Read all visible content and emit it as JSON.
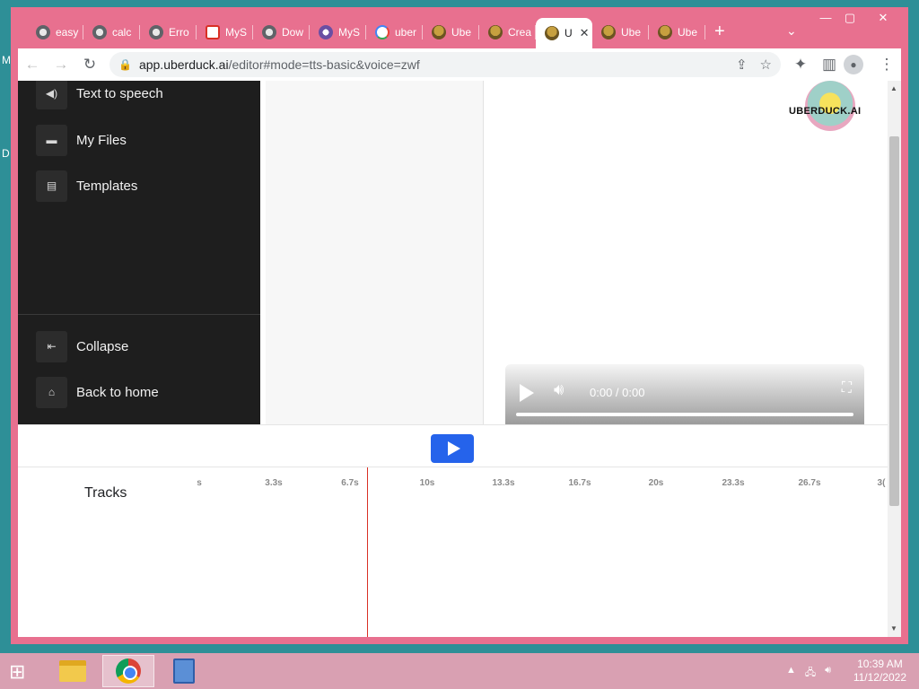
{
  "desktop": {
    "labels": [
      "M",
      "D"
    ]
  },
  "tabs": [
    {
      "label": "easy",
      "icon": "globe"
    },
    {
      "label": "calc",
      "icon": "globe"
    },
    {
      "label": "Erro",
      "icon": "globe"
    },
    {
      "label": "MyS",
      "icon": "red"
    },
    {
      "label": "Dow",
      "icon": "globe"
    },
    {
      "label": "MyS",
      "icon": "owl"
    },
    {
      "label": "uber",
      "icon": "google"
    },
    {
      "label": "Ube",
      "icon": "duck"
    },
    {
      "label": "Crea",
      "icon": "duck"
    },
    {
      "label": "U",
      "icon": "duck",
      "active": true
    },
    {
      "label": "Ube",
      "icon": "duck"
    },
    {
      "label": "Ube",
      "icon": "duck"
    }
  ],
  "address_bar": {
    "host": "app.uberduck.ai",
    "path": "/editor#mode=tts-basic&voice=zwf"
  },
  "sidebar": {
    "items": [
      {
        "label": "Text to speech",
        "icon": "speaker-icon"
      },
      {
        "label": "My Files",
        "icon": "folder-icon"
      },
      {
        "label": "Templates",
        "icon": "template-icon"
      }
    ],
    "bottom_items": [
      {
        "label": "Collapse",
        "icon": "collapse-icon"
      },
      {
        "label": "Back to home",
        "icon": "home-icon"
      }
    ]
  },
  "brand": {
    "logo_text": "UBERDUCK.AI"
  },
  "video_player": {
    "time": "0:00 / 0:00",
    "progress": 0
  },
  "timeline": {
    "tracks_label": "Tracks",
    "ticks": [
      "s",
      "3.3s",
      "6.7s",
      "10s",
      "13.3s",
      "16.7s",
      "20s",
      "23.3s",
      "26.7s",
      "3("
    ]
  },
  "taskbar": {
    "time": "10:39 AM",
    "date": "11/12/2022"
  },
  "colors": {
    "tab_strip": "#e8708f",
    "sidebar": "#1e1e1e",
    "play_button": "#2563eb",
    "playhead": "#d93025"
  }
}
